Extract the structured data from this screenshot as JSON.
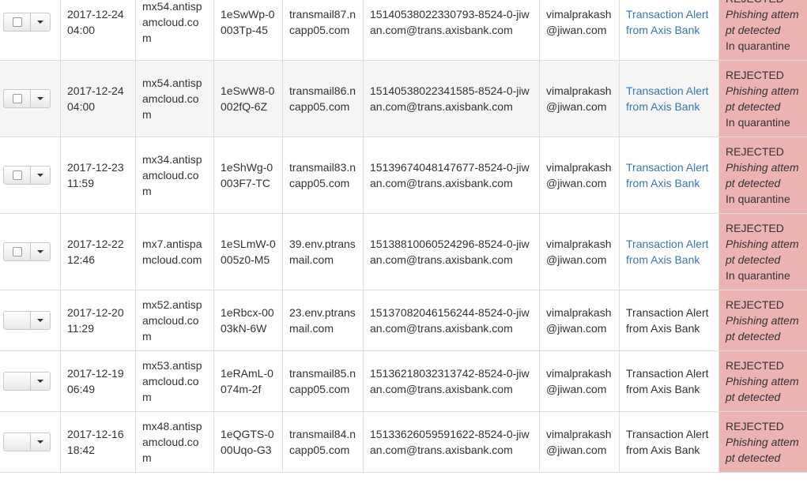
{
  "colors": {
    "rejected_bg": "#ecb3b3",
    "link": "#3a75b4",
    "border": "#dddddd",
    "alt_row": "#f5f5f5"
  },
  "rows": [
    {
      "date": "2017-12-24 04:00",
      "host": "mx54.antispamcloud.com",
      "id": "1eSwWp-0003Tp-45",
      "relay": "transmail87.ncapp05.com",
      "sender": "15140538022330793-8524-0-jiwan.com@trans.axisbank.com",
      "recipient": "vimalprakash@jiwan.com",
      "subject": "Transaction Alert from Axis Bank",
      "subject_link": true,
      "status": "REJECTED",
      "reason": "Phishing attempt detected",
      "extra": "In quarantine",
      "has_checkbox": true,
      "alt": false,
      "height": 97
    },
    {
      "date": "2017-12-24 04:00",
      "host": "mx54.antispamcloud.com",
      "id": "1eSwW8-0002fQ-6Z",
      "relay": "transmail86.ncapp05.com",
      "sender": "15140538022341585-8524-0-jiwan.com@trans.axisbank.com",
      "recipient": "vimalprakash@jiwan.com",
      "subject": "Transaction Alert from Axis Bank",
      "subject_link": true,
      "status": "REJECTED",
      "reason": "Phishing attempt detected",
      "extra": "In quarantine",
      "has_checkbox": true,
      "alt": true,
      "height": 97
    },
    {
      "date": "2017-12-23 11:59",
      "host": "mx34.antispamcloud.com",
      "id": "1eShWg-0003F7-TC",
      "relay": "transmail83.ncapp05.com",
      "sender": "15139674048147677-8524-0-jiwan.com@trans.axisbank.com",
      "recipient": "vimalprakash@jiwan.com",
      "subject": "Transaction Alert from Axis Bank",
      "subject_link": true,
      "status": "REJECTED",
      "reason": "Phishing attempt detected",
      "extra": "In quarantine",
      "has_checkbox": true,
      "alt": false,
      "height": 97
    },
    {
      "date": "2017-12-22 12:46",
      "host": "mx7.antispamcloud.com",
      "id": "1eSLmW-0005z0-M5",
      "relay": "39.env.ptransmail.com",
      "sender": "15138810060524296-8524-0-jiwan.com@trans.axisbank.com",
      "recipient": "vimalprakash@jiwan.com",
      "subject": "Transaction Alert from Axis Bank",
      "subject_link": true,
      "status": "REJECTED",
      "reason": "Phishing attempt detected",
      "extra": "In quarantine",
      "has_checkbox": true,
      "alt": false,
      "height": 97
    },
    {
      "date": "2017-12-20 11:29",
      "host": "mx52.antispamcloud.com",
      "id": "1eRbcx-0003kN-6W",
      "relay": "23.env.ptransmail.com",
      "sender": "15137082046156244-8524-0-jiwan.com@trans.axisbank.com",
      "recipient": "vimalprakash@jiwan.com",
      "subject": "Transaction Alert from Axis Bank",
      "subject_link": false,
      "status": "REJECTED",
      "reason": "Phishing attempt detected",
      "extra": "",
      "has_checkbox": false,
      "alt": false,
      "height": 77
    },
    {
      "date": "2017-12-19 06:49",
      "host": "mx53.antispamcloud.com",
      "id": "1eRAmL-0074m-2f",
      "relay": "transmail85.ncapp05.com",
      "sender": "15136218032313742-8524-0-jiwan.com@trans.axisbank.com",
      "recipient": "vimalprakash@jiwan.com",
      "subject": "Transaction Alert from Axis Bank",
      "subject_link": false,
      "status": "REJECTED",
      "reason": "Phishing attempt detected",
      "extra": "",
      "has_checkbox": false,
      "alt": false,
      "height": 77
    },
    {
      "date": "2017-12-16 18:42",
      "host": "mx48.antispamcloud.com",
      "id": "1eQGTS-000Uqo-G3",
      "relay": "transmail84.ncapp05.com",
      "sender": "15133626059591622-8524-0-jiwan.com@trans.axisbank.com",
      "recipient": "vimalprakash@jiwan.com",
      "subject": "Transaction Alert from Axis Bank",
      "subject_link": false,
      "status": "REJECTED",
      "reason": "Phishing attempt detected",
      "extra": "",
      "has_checkbox": false,
      "alt": false,
      "height": 77
    }
  ]
}
